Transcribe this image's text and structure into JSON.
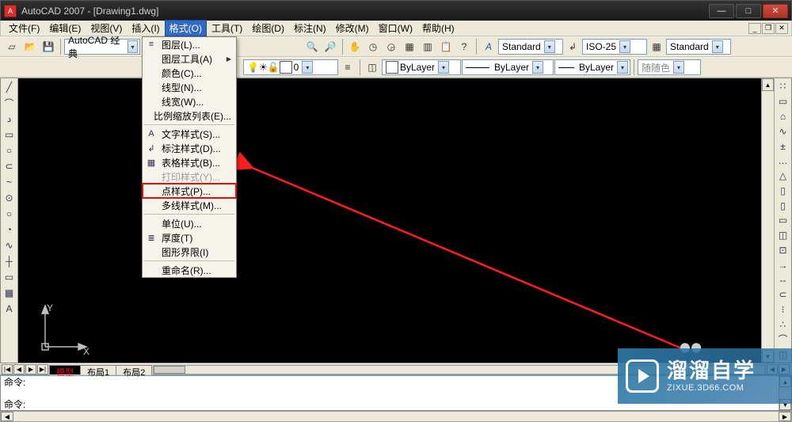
{
  "title": {
    "app": "AutoCAD 2007",
    "doc": "[Drawing1.dwg]"
  },
  "winbtns": {
    "min": "—",
    "max": "□",
    "close": "✕"
  },
  "menubar": {
    "items": [
      {
        "label": "文件(F)"
      },
      {
        "label": "编辑(E)"
      },
      {
        "label": "视图(V)"
      },
      {
        "label": "插入(I)"
      },
      {
        "label": "格式(O)",
        "open": true
      },
      {
        "label": "工具(T)"
      },
      {
        "label": "绘图(D)"
      },
      {
        "label": "标注(N)"
      },
      {
        "label": "修改(M)"
      },
      {
        "label": "窗口(W)"
      },
      {
        "label": "帮助(H)"
      }
    ]
  },
  "dropdown": {
    "items": [
      {
        "label": "图层(L)...",
        "icon": "≡"
      },
      {
        "label": "图层工具(A)",
        "submenu": true
      },
      {
        "label": "颜色(C)...",
        "icon": ""
      },
      {
        "label": "线型(N)..."
      },
      {
        "label": "线宽(W)..."
      },
      {
        "label": "比例缩放列表(E)..."
      },
      {
        "sep": true
      },
      {
        "label": "文字样式(S)...",
        "icon": "A"
      },
      {
        "label": "标注样式(D)...",
        "icon": "↲"
      },
      {
        "label": "表格样式(B)...",
        "icon": "▦"
      },
      {
        "label": "打印样式(Y)...",
        "disabled": true
      },
      {
        "label": "点样式(P)...",
        "highlight": true
      },
      {
        "label": "多线样式(M)..."
      },
      {
        "sep": true
      },
      {
        "label": "单位(U)..."
      },
      {
        "label": "厚度(T)",
        "icon": "≣"
      },
      {
        "label": "图形界限(I)"
      },
      {
        "sep": true
      },
      {
        "label": "重命名(R)..."
      }
    ]
  },
  "toolbar1": {
    "workspace_label": "AutoCAD 经典",
    "text_style": "Standard",
    "dim_style": "ISO-25",
    "table_style": "Standard"
  },
  "toolbar2": {
    "layer_color": "#ffffff",
    "bylayer1": "ByLayer",
    "bylayer2": "ByLayer",
    "bylayer3": "ByLayer",
    "color_combo": "随随色"
  },
  "tabs": {
    "nav": [
      "|◀",
      "◀",
      "▶",
      "▶|"
    ],
    "items": [
      {
        "label": "模型",
        "active": true
      },
      {
        "label": "布局1"
      },
      {
        "label": "布局2"
      }
    ]
  },
  "cmd": {
    "l1": "命令:",
    "l2": "命令:"
  },
  "ucs": {
    "x": "X",
    "y": "Y"
  },
  "watermark": {
    "cn": "溜溜自学",
    "en": "ZIXUE.3D66.COM"
  },
  "left_icons": [
    "╱",
    "⌒",
    "د",
    "▭",
    "○",
    "⊂",
    "~",
    "⊙",
    "○",
    "◔",
    "∿",
    "┼",
    "▭",
    "▦",
    "A"
  ],
  "right_icons": [
    "∷",
    "▭",
    "⌂",
    "∿",
    "±",
    "…",
    "△",
    "▯",
    "▯",
    "▭",
    "◫",
    "⊡",
    "→",
    "--",
    "⊂",
    "⁝",
    "∴",
    "⌒",
    "◫"
  ]
}
